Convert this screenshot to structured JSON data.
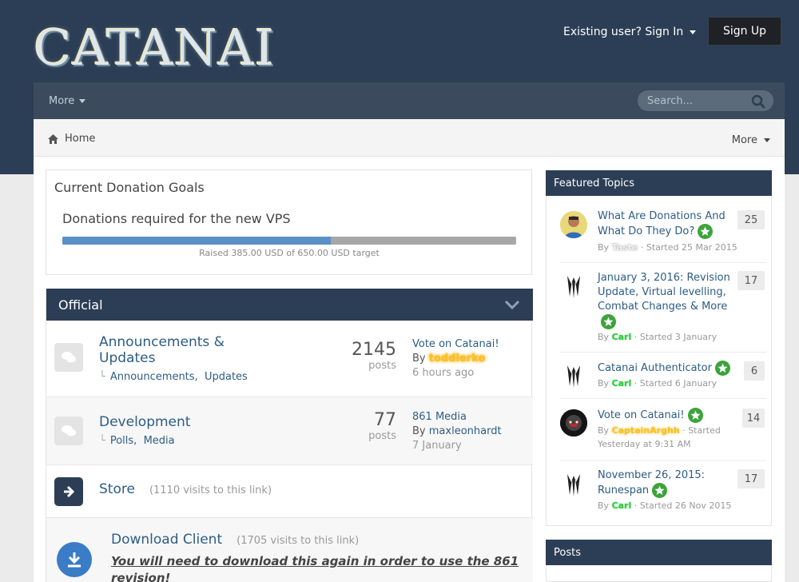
{
  "brand": {
    "logo_text": "CATANAI"
  },
  "header": {
    "signin_label": "Existing user? Sign In",
    "signup_label": "Sign Up"
  },
  "nav": {
    "more_label": "More",
    "search_placeholder": "Search..."
  },
  "breadcrumb": {
    "home_label": "Home",
    "more_label": "More"
  },
  "donation": {
    "title": "Current Donation Goals",
    "subtitle": "Donations required for the new VPS",
    "raised_text": "Raised 385.00 USD of 650.00 USD target",
    "raised": 385.0,
    "target": 650.0
  },
  "official": {
    "title": "Official",
    "forums": [
      {
        "title": "Announcements & Updates",
        "subforums": [
          "Announcements",
          "Updates"
        ],
        "count": "2145",
        "count_label": "posts",
        "last_topic": "Vote on Catanai!",
        "by_label": "By",
        "last_user": "toddlerko",
        "last_time": "6 hours ago"
      },
      {
        "title": "Development",
        "subforums": [
          "Polls",
          "Media"
        ],
        "count": "77",
        "count_label": "posts",
        "last_topic": "861 Media",
        "by_label": "By",
        "last_user": "maxleonhardt",
        "last_time": "7 January"
      }
    ],
    "store": {
      "title": "Store",
      "visits": "(1110 visits to this link)"
    },
    "download": {
      "title": "Download Client",
      "visits": "(1705 visits to this link)",
      "note": "You will need to download this again in order to use the 861 revision!"
    }
  },
  "featured": {
    "title": "Featured Topics",
    "topics": [
      {
        "title": "What Are Donations And What Do They Do?",
        "by": "By",
        "user": "Taste",
        "started": "· Started 25 Mar 2015",
        "count": "25"
      },
      {
        "title": "January 3, 2016: Revision Update, Virtual levelling, Combat Changes & More",
        "by": "By",
        "user": "Carl",
        "started": "· Started 3 January",
        "count": "17"
      },
      {
        "title": "Catanai Authenticator",
        "by": "By",
        "user": "Carl",
        "started": "· Started 6 January",
        "count": "6"
      },
      {
        "title": "Vote on Catanai!",
        "by": "By",
        "user": "CaptainArghh",
        "started": "· Started Yesterday at 9:31 AM",
        "count": "14"
      },
      {
        "title": "November 26, 2015: Runespan",
        "by": "By",
        "user": "Carl",
        "started": "· Started 26 Nov 2015",
        "count": "17"
      }
    ]
  },
  "posts": {
    "title": "Posts"
  },
  "colors": {
    "primary": "#2c3e55",
    "link": "#2d5c85",
    "progress": "#5b8fc7",
    "pinned": "#3ca43a"
  }
}
